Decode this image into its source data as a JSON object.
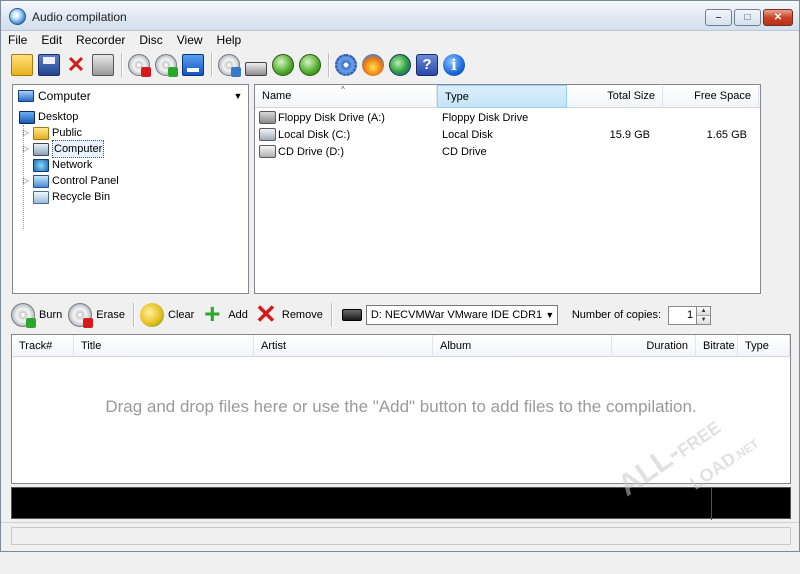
{
  "window": {
    "title": "Audio compilation",
    "buttons": {
      "minimize": "–",
      "maximize": "□",
      "close": "✕"
    }
  },
  "menu": [
    "File",
    "Edit",
    "Recorder",
    "Disc",
    "View",
    "Help"
  ],
  "toolbar": {
    "icons": [
      "open-file",
      "save",
      "delete",
      "print",
      "disc-erase",
      "disc-burn",
      "blue-window",
      "disc-info",
      "drive",
      "green-arrow-down",
      "green-arrow-up",
      "settings-gear",
      "burning-flame",
      "globe-search",
      "help",
      "info"
    ]
  },
  "folder_tree": {
    "combo_value": "Computer",
    "nodes": [
      {
        "label": "Desktop",
        "icon": "desktop-icon",
        "level": 0
      },
      {
        "label": "Public",
        "icon": "folder-icon",
        "level": 1,
        "expander": "▷"
      },
      {
        "label": "Computer",
        "icon": "computer-icon",
        "level": 1,
        "expander": "▷",
        "selected": true
      },
      {
        "label": "Network",
        "icon": "network-icon",
        "level": 1,
        "expander": ""
      },
      {
        "label": "Control Panel",
        "icon": "control-panel-icon",
        "level": 1,
        "expander": "▷"
      },
      {
        "label": "Recycle Bin",
        "icon": "recycle-bin-icon",
        "level": 1,
        "expander": ""
      }
    ]
  },
  "file_list": {
    "columns": [
      "Name",
      "Type",
      "Total Size",
      "Free Space"
    ],
    "sort_indicator": "^",
    "rows": [
      {
        "name": "Floppy Disk Drive (A:)",
        "type": "Floppy Disk Drive",
        "total": "",
        "free": "",
        "icon": "floppy-drive-icon"
      },
      {
        "name": "Local Disk (C:)",
        "type": "Local Disk",
        "total": "15.9 GB",
        "free": "1.65 GB",
        "icon": "local-disk-icon"
      },
      {
        "name": "CD Drive (D:)",
        "type": "CD Drive",
        "total": "",
        "free": "",
        "icon": "cd-drive-icon"
      }
    ]
  },
  "compilation_toolbar": {
    "burn": "Burn",
    "erase": "Erase",
    "clear": "Clear",
    "add": "Add",
    "remove": "Remove",
    "drive": "D: NECVMWar VMware IDE CDR1",
    "copies_label": "Number of copies:",
    "copies_value": "1"
  },
  "track_list": {
    "columns": [
      "Track#",
      "Title",
      "Artist",
      "Album",
      "Duration",
      "Bitrate",
      "Type"
    ],
    "empty_message": "Drag and drop files here or use the \"Add\" button to add files to the compilation."
  },
  "watermark": {
    "line1": "ALL-",
    "line2": "FREE",
    "line3": "LOAD",
    "suffix": ".NET"
  }
}
